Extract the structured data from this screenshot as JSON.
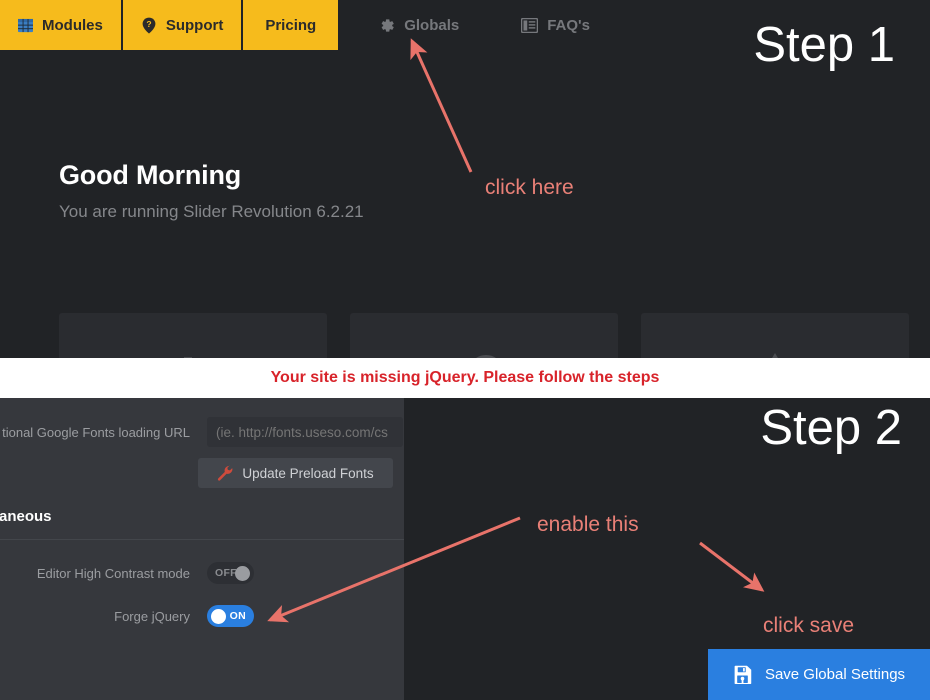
{
  "colors": {
    "nav_yellow": "#F6BB1C",
    "dark_bg": "#212326",
    "panel_bg": "#36383D",
    "accent_blue": "#2A7FE0",
    "annotation_red": "#E98077",
    "banner_red": "#D8232A"
  },
  "step1": {
    "step_label": "Step 1",
    "nav": {
      "tabs": [
        {
          "label": "Modules",
          "icon": "grid-icon",
          "active": true
        },
        {
          "label": "Support",
          "icon": "question-pin-icon",
          "active": true
        },
        {
          "label": "Pricing",
          "icon": "none",
          "active": true
        }
      ],
      "links": [
        {
          "label": "Globals",
          "icon": "gear-icon"
        },
        {
          "label": "FAQ's",
          "icon": "book-icon"
        }
      ]
    },
    "greeting": {
      "title": "Good Morning",
      "subtitle": "You are running Slider Revolution 6.2.21"
    },
    "cards": [
      {
        "icon": "sliders-icon"
      },
      {
        "icon": "cloud-icon"
      },
      {
        "icon": "triangle-icon"
      }
    ],
    "annotation": {
      "click_here": "click here"
    }
  },
  "banner": {
    "message": "Your site is missing jQuery. Please follow the steps"
  },
  "step2": {
    "step_label": "Step 2",
    "fonts_row": {
      "label": "tional Google Fonts loading URL",
      "input_value": "",
      "input_placeholder": "(ie. http://fonts.useso.com/cs"
    },
    "preload_button": {
      "label": "Update Preload Fonts",
      "icon": "wrench-icon"
    },
    "section_title": "aneous",
    "settings": [
      {
        "label": "Editor High Contrast mode",
        "state": "OFF",
        "on": false
      },
      {
        "label": "Forge jQuery",
        "state": "ON",
        "on": true
      }
    ],
    "save_button": {
      "label": "Save Global Settings",
      "icon": "save-floppy-icon"
    },
    "annotations": {
      "enable_this": "enable this",
      "click_save": "click save"
    }
  }
}
